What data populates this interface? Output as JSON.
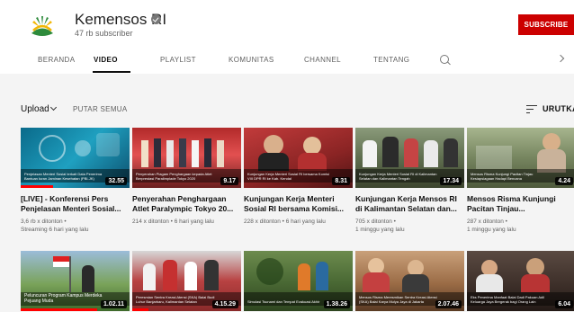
{
  "channel": {
    "name": "Kemensos RI",
    "subscribers": "47 rb subscriber",
    "subscribe_label": "SUBSCRIBE",
    "accent": "#cc0000"
  },
  "tabs": [
    {
      "label": "BERANDA"
    },
    {
      "label": "VIDEO"
    },
    {
      "label": "PLAYLIST"
    },
    {
      "label": "KOMUNITAS"
    },
    {
      "label": "CHANNEL"
    },
    {
      "label": "TENTANG"
    }
  ],
  "toolbar": {
    "upload_label": "Upload",
    "play_all_label": "PUTAR SEMUA",
    "sort_label": "URUTKAN"
  },
  "videos": [
    {
      "title": "[LIVE] - Konferensi Pers Penjelasan Menteri Sosial...",
      "views": "3,6 rb x ditonton •",
      "time": "Streaming 6 hari yang lalu",
      "duration": "32.55",
      "thumb_caption": "Penjelasan Menteri Sosial terkait Data Penerima Bantuan Iuran Jaminan Kesehatan (PBI-JK)",
      "progress": 0.3
    },
    {
      "title": "Penyerahan Penghargaan Atlet Paralympic Tokyo 20...",
      "views": "214 x ditonton • 6 hari yang lalu",
      "time": "",
      "duration": "9.17",
      "thumb_caption": "Penyerahan Piagam Penghargaan kepada Atlet Berprestasi Paralimpiade Tokyo 2020",
      "progress": 0
    },
    {
      "title": "Kunjungan Kerja Menteri Sosial RI bersama Komisi...",
      "views": "228 x ditonton • 6 hari yang lalu",
      "time": "",
      "duration": "8.31",
      "thumb_caption": "Kunjungan Kerja Menteri Sosial RI bersama Komisi VIII DPR RI ke Kab. Kendal",
      "progress": 0
    },
    {
      "title": "Kunjungan Kerja Mensos RI di Kalimantan Selatan dan...",
      "views": "705 x ditonton •",
      "time": "1 minggu yang lalu",
      "duration": "17.34",
      "thumb_caption": "Kunjungan Kerja Menteri Sosial RI di Kalimantan Selatan dan Kalimantan Tengah",
      "progress": 0
    },
    {
      "title": "Mensos Risma Kunjungi Pacitan Tinjau...",
      "views": "287 x ditonton •",
      "time": "1 minggu yang lalu",
      "duration": "4.24",
      "thumb_caption": "Mensos Risma Kunjungi Pacitan Tinjau Kesiapsiagaan Hadapi Bencana",
      "progress": 0
    },
    {
      "title": "",
      "views": "",
      "time": "",
      "duration": "1.02.11",
      "thumb_caption": "Peluncuran Program Kampus Merdeka Pejuang Muda",
      "progress": 0.7
    },
    {
      "title": "",
      "views": "",
      "time": "",
      "duration": "4.15.29",
      "thumb_caption": "Peresmian Sentra Kreasi Atensi (SKA) Balai Budi Luhur Banjarbaru, Kalimantan Selatan",
      "progress": 0.15
    },
    {
      "title": "",
      "views": "",
      "time": "",
      "duration": "1.38.26",
      "thumb_caption": "Simulasi Tsunami dan Tempat Evakuasi Akhir",
      "progress": 0
    },
    {
      "title": "",
      "views": "",
      "time": "",
      "duration": "2.07.46",
      "thumb_caption": "Mensos Risma Meresmikan Sentra Kreasi Atensi (SKA) Balai Karya Mulya Jaya di Jakarta",
      "progress": 0
    },
    {
      "title": "",
      "views": "",
      "time": "",
      "duration": "6.04",
      "thumb_caption": "Eks Penerima Manfaat Balai Dadi Pakuan Adil Keluarga Jaya Bergerak bagi Orang Lain",
      "progress": 0
    }
  ]
}
